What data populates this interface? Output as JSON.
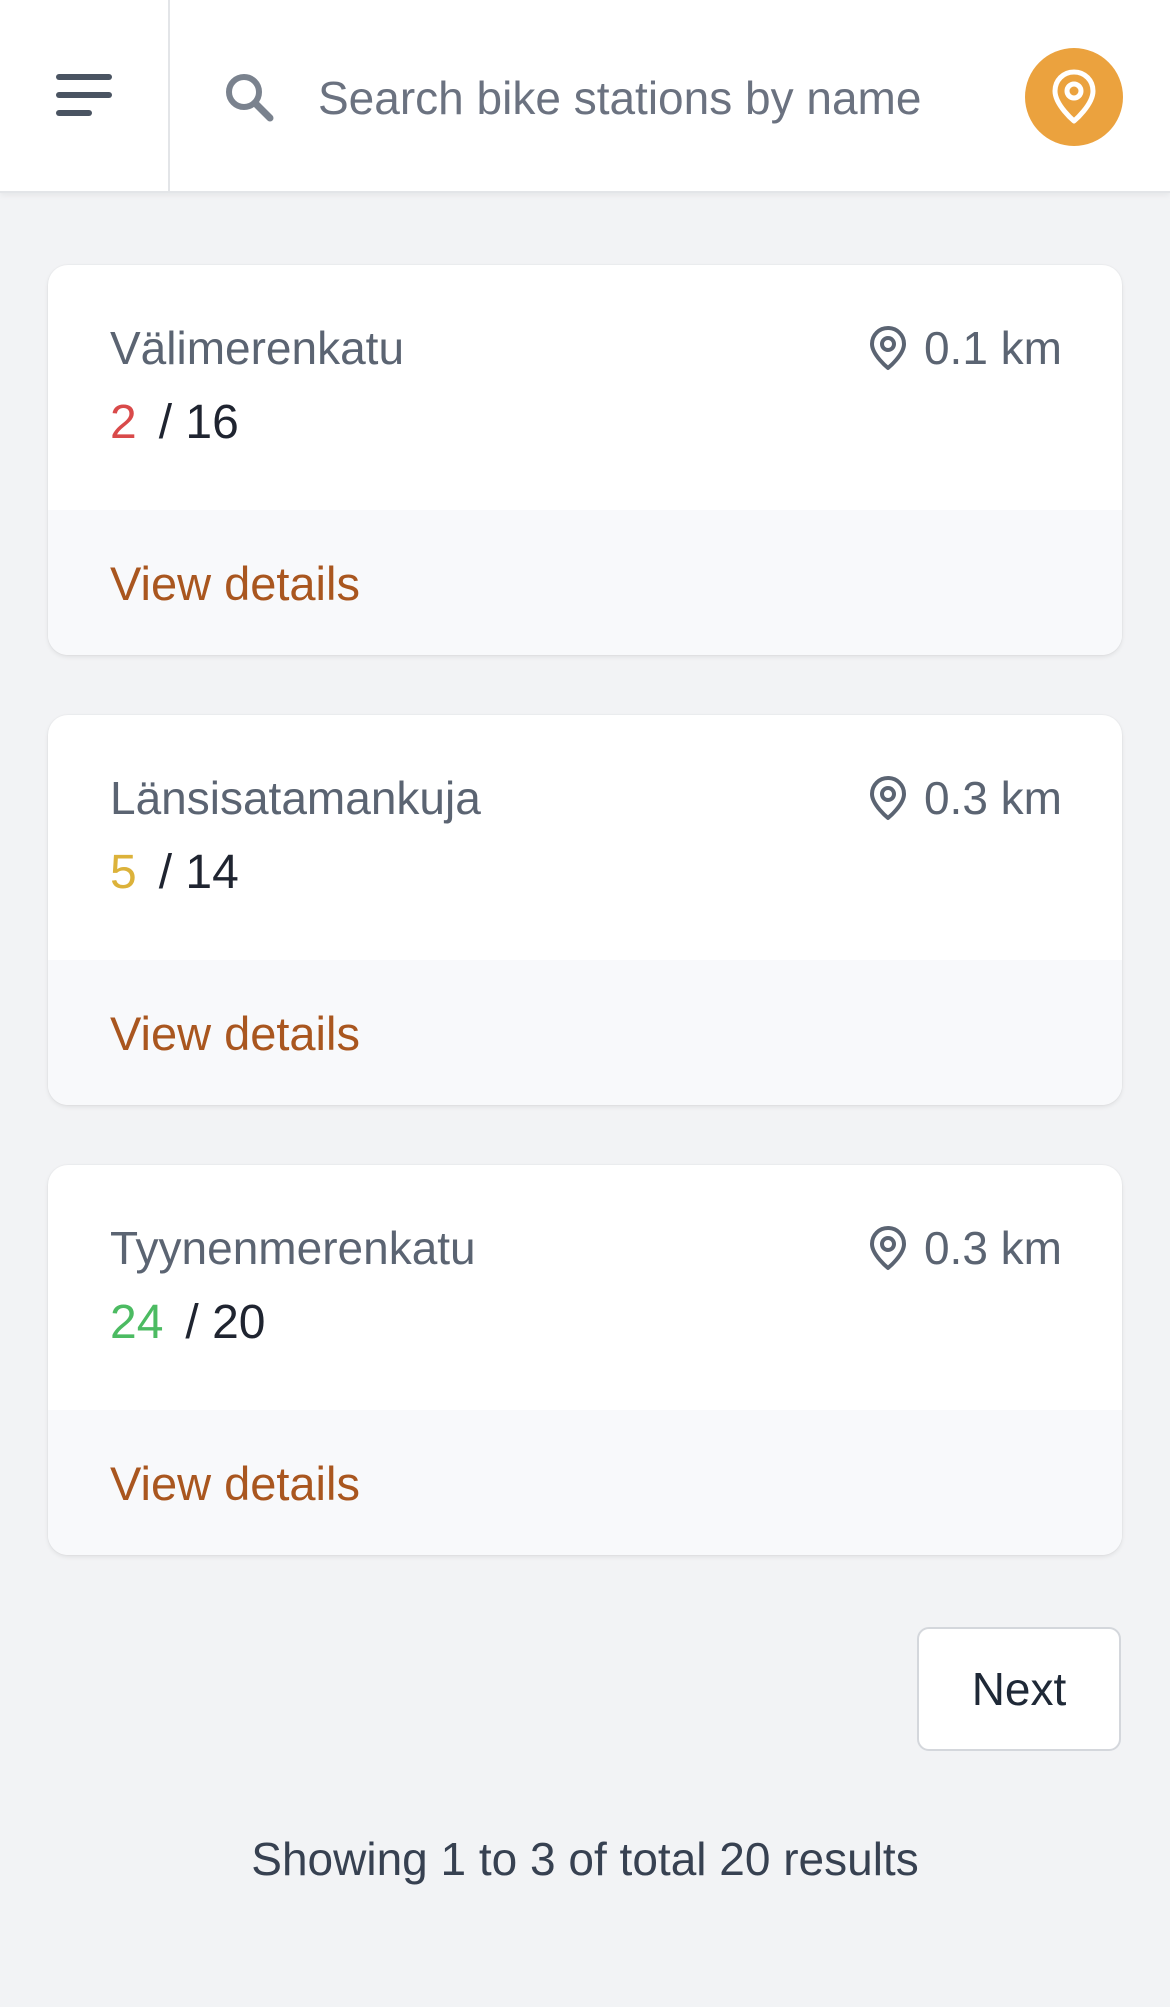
{
  "header": {
    "menu_icon": "hamburger-menu-icon",
    "search_icon": "search-icon",
    "search": {
      "placeholder": "Search bike stations by name",
      "value": ""
    },
    "locate_icon": "location-pin-icon",
    "accent_color": "#eba23e"
  },
  "stations": [
    {
      "name": "Välimerenkatu",
      "distance": "0.1 km",
      "available": "2",
      "capacity": "/ 16",
      "status_color": "#d94a4a",
      "link_label": "View details"
    },
    {
      "name": "Länsisatamankuja",
      "distance": "0.3 km",
      "available": "5",
      "capacity": "/ 14",
      "status_color": "#dcb23a",
      "link_label": "View details"
    },
    {
      "name": "Tyynenmerenkatu",
      "distance": "0.3 km",
      "available": "24",
      "capacity": "/ 20",
      "status_color": "#4cbb62",
      "link_label": "View details"
    }
  ],
  "pagination": {
    "next_label": "Next",
    "summary": "Showing 1 to 3 of total 20 results"
  },
  "colors": {
    "link": "#a9561f",
    "background": "#f2f3f5"
  }
}
